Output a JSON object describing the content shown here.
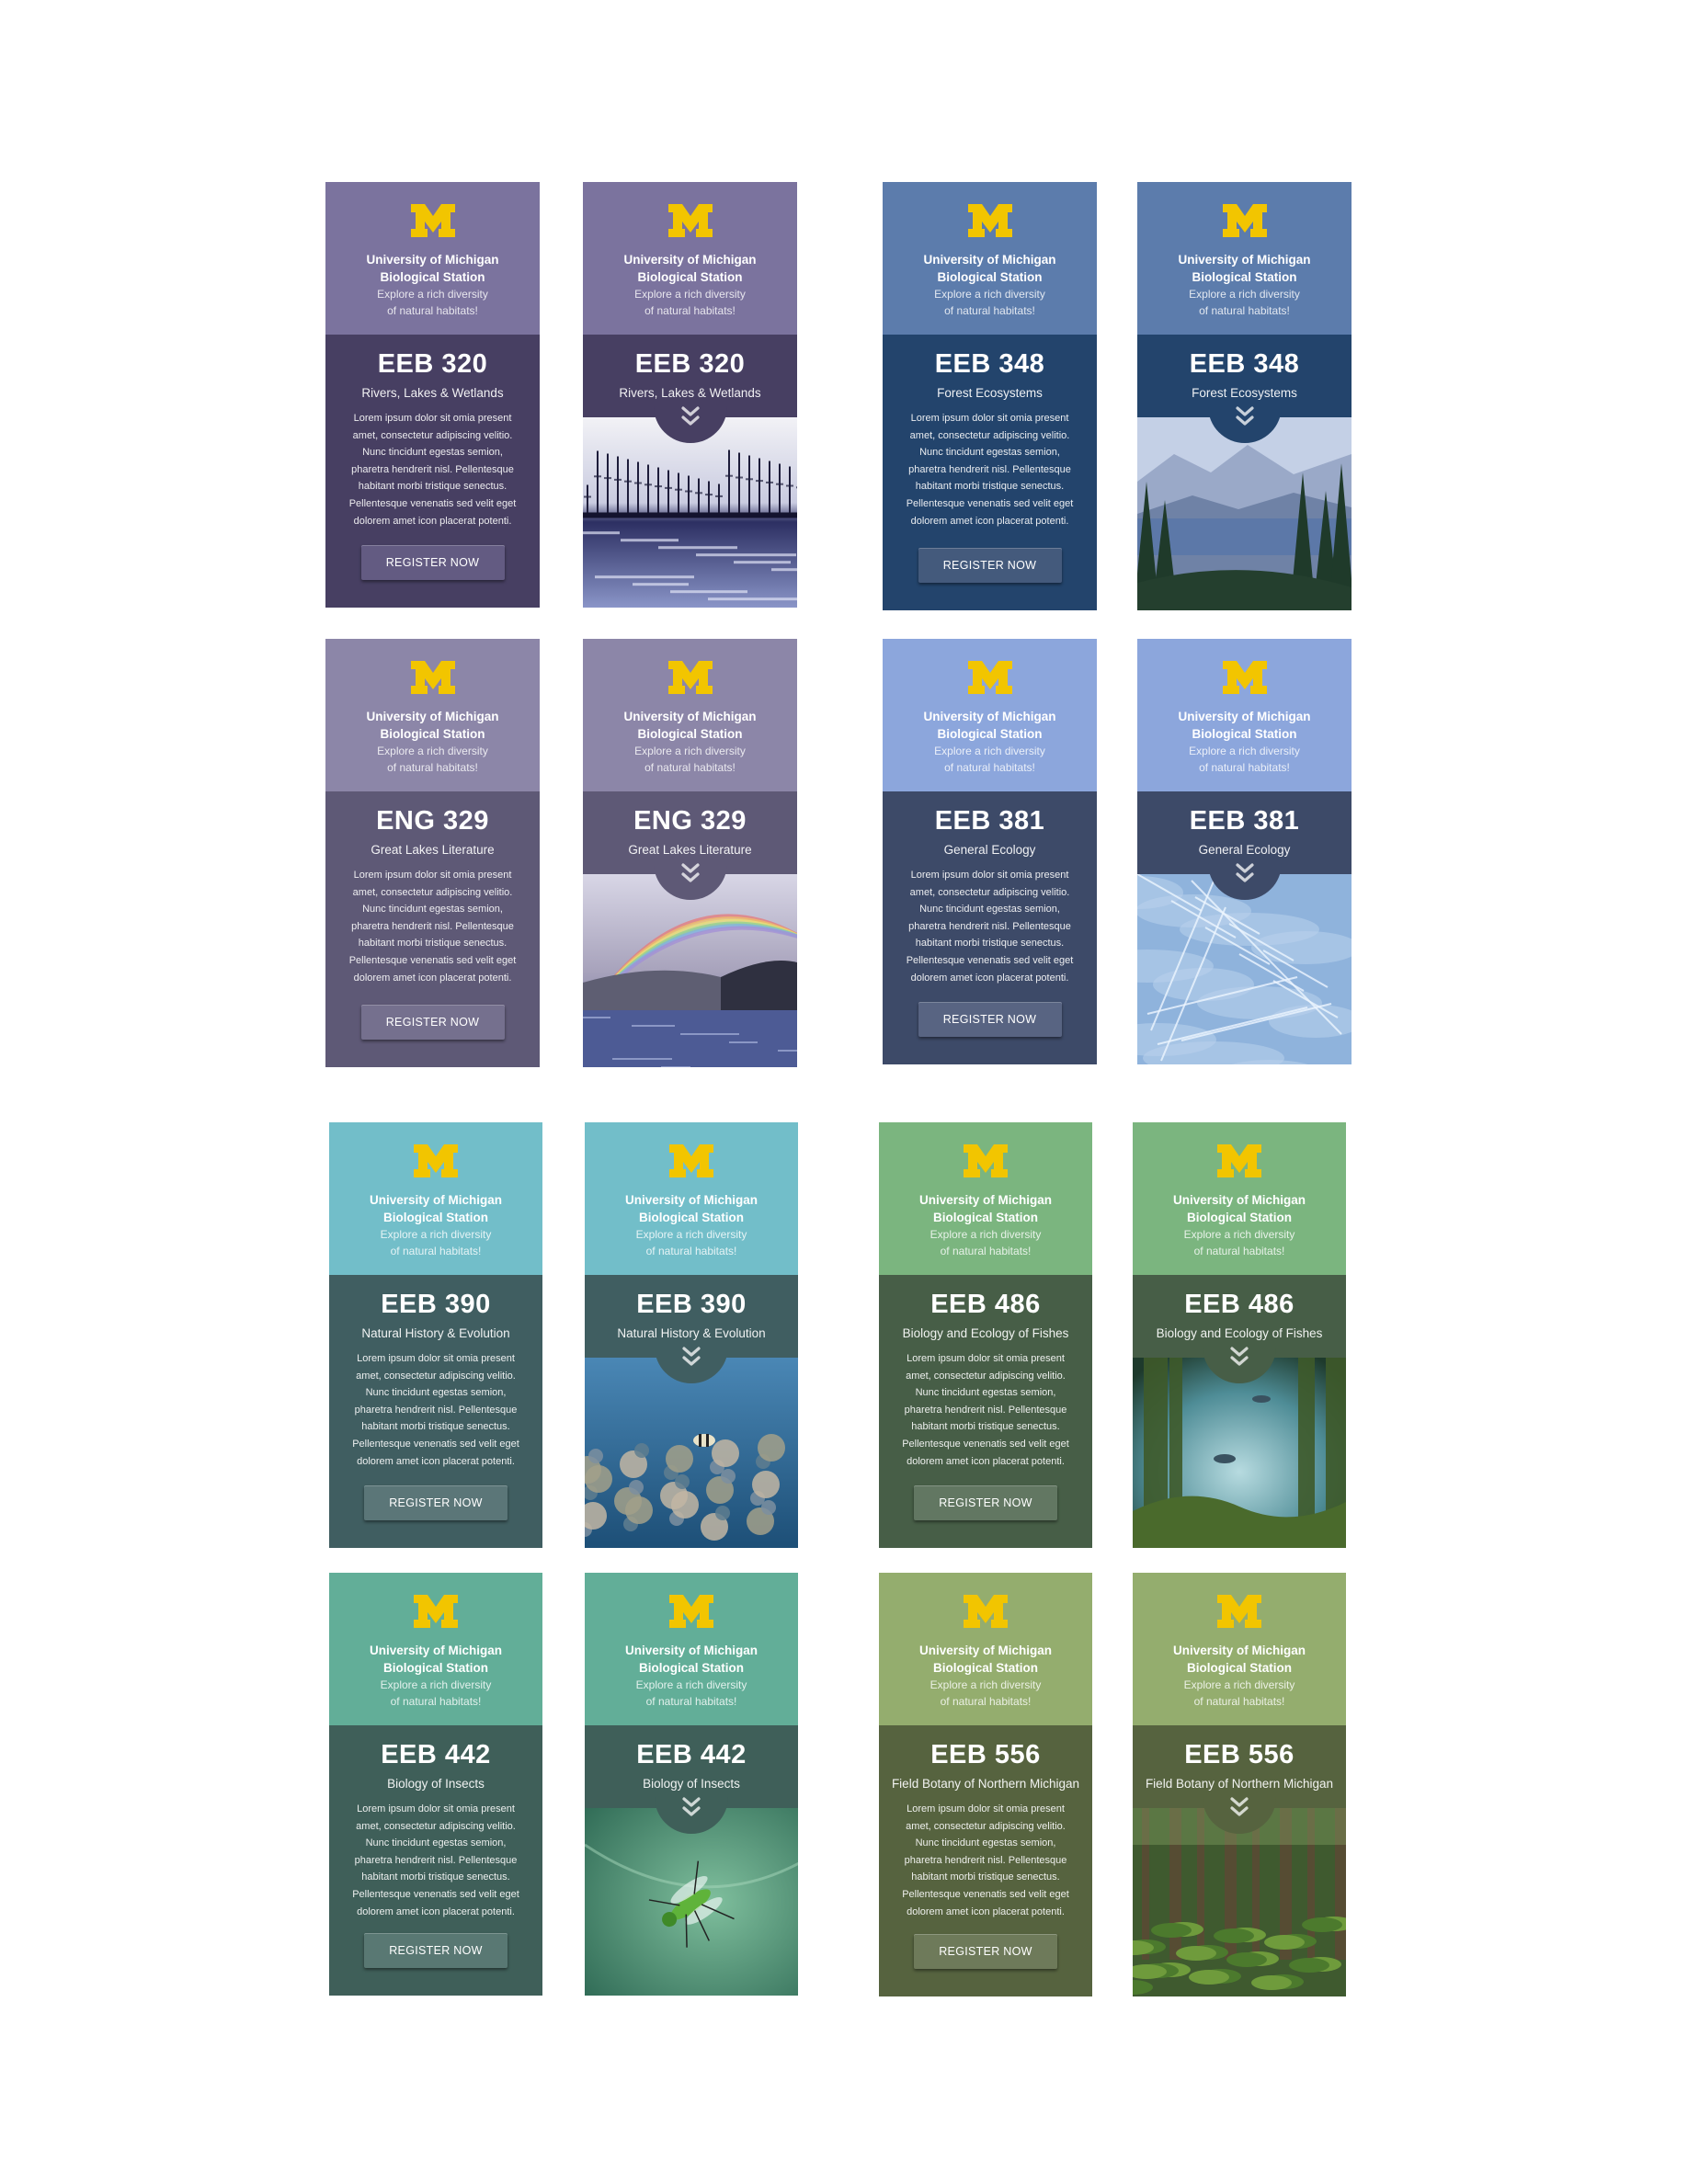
{
  "brand": {
    "org_line1": "University of Michigan",
    "org_line2": "Biological Station",
    "tagline_line1": "Explore a rich diversity",
    "tagline_line2": "of natural habitats!",
    "logo_letter": "M",
    "logo_color": "#f2c500"
  },
  "description": [
    "Lorem ipsum dolor sit omia present",
    "amet, consectetur adipiscing velitio.",
    "Nunc tincidunt egestas semion,",
    "pharetra hendrerit nisl. Pellentesque",
    "habitant morbi tristique senectus.",
    "Pellentesque venenatis sed velit eget",
    "dolorem amet icon placerat potenti."
  ],
  "button_label": "REGISTER NOW",
  "courses": [
    {
      "code": "EEB 320",
      "title": "Rivers, Lakes & Wetlands",
      "top_color": "#7b739e",
      "bottom_color": "#473f62",
      "button_color": "#635b82",
      "photo": "frozen-lake-with-trees"
    },
    {
      "code": "EEB 348",
      "title": "Forest Ecosystems",
      "top_color": "#5c7cac",
      "bottom_color": "#23446c",
      "button_color": "#445a7c",
      "photo": "mountain-lake-forest"
    },
    {
      "code": "ENG 329",
      "title": "Great Lakes Literature",
      "top_color": "#8c86a8",
      "bottom_color": "#5e5976",
      "button_color": "#75708e",
      "photo": "rainbow-over-lake"
    },
    {
      "code": "EEB 381",
      "title": "General Ecology",
      "top_color": "#8ca6dc",
      "bottom_color": "#3d4a68",
      "button_color": "#586482",
      "photo": "ice-sheet"
    },
    {
      "code": "EEB 390",
      "title": "Natural History & Evolution",
      "top_color": "#72bec9",
      "bottom_color": "#405e61",
      "button_color": "#5b7678",
      "photo": "coral-reef"
    },
    {
      "code": "EEB 486",
      "title": "Biology and Ecology of Fishes",
      "top_color": "#7bb57f",
      "bottom_color": "#475e47",
      "button_color": "#627762",
      "photo": "kelp-forest-fish"
    },
    {
      "code": "EEB 442",
      "title": "Biology of Insects",
      "top_color": "#62ae98",
      "bottom_color": "#3f5f59",
      "button_color": "#597873",
      "photo": "green-fly-on-leaf"
    },
    {
      "code": "EEB 556",
      "title": "Field Botany of Northern Michigan",
      "top_color": "#94ad6e",
      "bottom_color": "#56633f",
      "button_color": "#6e7a5a",
      "photo": "fern-forest"
    }
  ]
}
